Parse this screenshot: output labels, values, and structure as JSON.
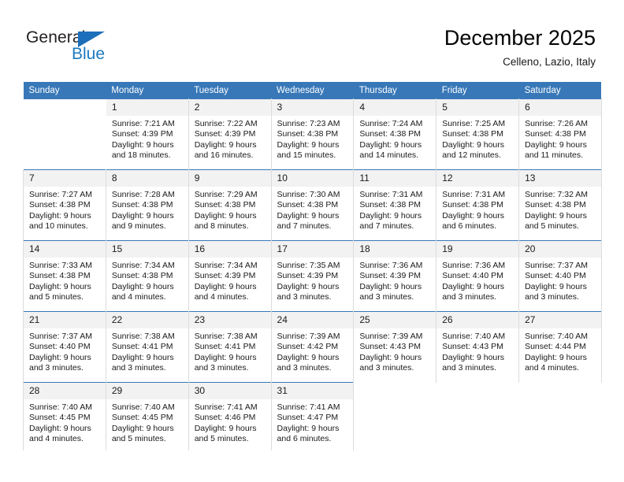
{
  "brand": {
    "name_part1": "General",
    "name_part2": "Blue",
    "accent_color": "#1c7ac0"
  },
  "header": {
    "month_title": "December 2025",
    "location": "Celleno, Lazio, Italy"
  },
  "calendar": {
    "header_bg": "#3878b8",
    "daynum_bg": "#f2f2f2",
    "weekday_headers": [
      "Sunday",
      "Monday",
      "Tuesday",
      "Wednesday",
      "Thursday",
      "Friday",
      "Saturday"
    ],
    "weeks": [
      [
        {
          "day": "",
          "sunrise": "",
          "sunset": "",
          "daylight1": "",
          "daylight2": "",
          "empty": true
        },
        {
          "day": "1",
          "sunrise": "Sunrise: 7:21 AM",
          "sunset": "Sunset: 4:39 PM",
          "daylight1": "Daylight: 9 hours",
          "daylight2": "and 18 minutes.",
          "empty": false
        },
        {
          "day": "2",
          "sunrise": "Sunrise: 7:22 AM",
          "sunset": "Sunset: 4:39 PM",
          "daylight1": "Daylight: 9 hours",
          "daylight2": "and 16 minutes.",
          "empty": false
        },
        {
          "day": "3",
          "sunrise": "Sunrise: 7:23 AM",
          "sunset": "Sunset: 4:38 PM",
          "daylight1": "Daylight: 9 hours",
          "daylight2": "and 15 minutes.",
          "empty": false
        },
        {
          "day": "4",
          "sunrise": "Sunrise: 7:24 AM",
          "sunset": "Sunset: 4:38 PM",
          "daylight1": "Daylight: 9 hours",
          "daylight2": "and 14 minutes.",
          "empty": false
        },
        {
          "day": "5",
          "sunrise": "Sunrise: 7:25 AM",
          "sunset": "Sunset: 4:38 PM",
          "daylight1": "Daylight: 9 hours",
          "daylight2": "and 12 minutes.",
          "empty": false
        },
        {
          "day": "6",
          "sunrise": "Sunrise: 7:26 AM",
          "sunset": "Sunset: 4:38 PM",
          "daylight1": "Daylight: 9 hours",
          "daylight2": "and 11 minutes.",
          "empty": false
        }
      ],
      [
        {
          "day": "7",
          "sunrise": "Sunrise: 7:27 AM",
          "sunset": "Sunset: 4:38 PM",
          "daylight1": "Daylight: 9 hours",
          "daylight2": "and 10 minutes.",
          "empty": false
        },
        {
          "day": "8",
          "sunrise": "Sunrise: 7:28 AM",
          "sunset": "Sunset: 4:38 PM",
          "daylight1": "Daylight: 9 hours",
          "daylight2": "and 9 minutes.",
          "empty": false
        },
        {
          "day": "9",
          "sunrise": "Sunrise: 7:29 AM",
          "sunset": "Sunset: 4:38 PM",
          "daylight1": "Daylight: 9 hours",
          "daylight2": "and 8 minutes.",
          "empty": false
        },
        {
          "day": "10",
          "sunrise": "Sunrise: 7:30 AM",
          "sunset": "Sunset: 4:38 PM",
          "daylight1": "Daylight: 9 hours",
          "daylight2": "and 7 minutes.",
          "empty": false
        },
        {
          "day": "11",
          "sunrise": "Sunrise: 7:31 AM",
          "sunset": "Sunset: 4:38 PM",
          "daylight1": "Daylight: 9 hours",
          "daylight2": "and 7 minutes.",
          "empty": false
        },
        {
          "day": "12",
          "sunrise": "Sunrise: 7:31 AM",
          "sunset": "Sunset: 4:38 PM",
          "daylight1": "Daylight: 9 hours",
          "daylight2": "and 6 minutes.",
          "empty": false
        },
        {
          "day": "13",
          "sunrise": "Sunrise: 7:32 AM",
          "sunset": "Sunset: 4:38 PM",
          "daylight1": "Daylight: 9 hours",
          "daylight2": "and 5 minutes.",
          "empty": false
        }
      ],
      [
        {
          "day": "14",
          "sunrise": "Sunrise: 7:33 AM",
          "sunset": "Sunset: 4:38 PM",
          "daylight1": "Daylight: 9 hours",
          "daylight2": "and 5 minutes.",
          "empty": false
        },
        {
          "day": "15",
          "sunrise": "Sunrise: 7:34 AM",
          "sunset": "Sunset: 4:38 PM",
          "daylight1": "Daylight: 9 hours",
          "daylight2": "and 4 minutes.",
          "empty": false
        },
        {
          "day": "16",
          "sunrise": "Sunrise: 7:34 AM",
          "sunset": "Sunset: 4:39 PM",
          "daylight1": "Daylight: 9 hours",
          "daylight2": "and 4 minutes.",
          "empty": false
        },
        {
          "day": "17",
          "sunrise": "Sunrise: 7:35 AM",
          "sunset": "Sunset: 4:39 PM",
          "daylight1": "Daylight: 9 hours",
          "daylight2": "and 3 minutes.",
          "empty": false
        },
        {
          "day": "18",
          "sunrise": "Sunrise: 7:36 AM",
          "sunset": "Sunset: 4:39 PM",
          "daylight1": "Daylight: 9 hours",
          "daylight2": "and 3 minutes.",
          "empty": false
        },
        {
          "day": "19",
          "sunrise": "Sunrise: 7:36 AM",
          "sunset": "Sunset: 4:40 PM",
          "daylight1": "Daylight: 9 hours",
          "daylight2": "and 3 minutes.",
          "empty": false
        },
        {
          "day": "20",
          "sunrise": "Sunrise: 7:37 AM",
          "sunset": "Sunset: 4:40 PM",
          "daylight1": "Daylight: 9 hours",
          "daylight2": "and 3 minutes.",
          "empty": false
        }
      ],
      [
        {
          "day": "21",
          "sunrise": "Sunrise: 7:37 AM",
          "sunset": "Sunset: 4:40 PM",
          "daylight1": "Daylight: 9 hours",
          "daylight2": "and 3 minutes.",
          "empty": false
        },
        {
          "day": "22",
          "sunrise": "Sunrise: 7:38 AM",
          "sunset": "Sunset: 4:41 PM",
          "daylight1": "Daylight: 9 hours",
          "daylight2": "and 3 minutes.",
          "empty": false
        },
        {
          "day": "23",
          "sunrise": "Sunrise: 7:38 AM",
          "sunset": "Sunset: 4:41 PM",
          "daylight1": "Daylight: 9 hours",
          "daylight2": "and 3 minutes.",
          "empty": false
        },
        {
          "day": "24",
          "sunrise": "Sunrise: 7:39 AM",
          "sunset": "Sunset: 4:42 PM",
          "daylight1": "Daylight: 9 hours",
          "daylight2": "and 3 minutes.",
          "empty": false
        },
        {
          "day": "25",
          "sunrise": "Sunrise: 7:39 AM",
          "sunset": "Sunset: 4:43 PM",
          "daylight1": "Daylight: 9 hours",
          "daylight2": "and 3 minutes.",
          "empty": false
        },
        {
          "day": "26",
          "sunrise": "Sunrise: 7:40 AM",
          "sunset": "Sunset: 4:43 PM",
          "daylight1": "Daylight: 9 hours",
          "daylight2": "and 3 minutes.",
          "empty": false
        },
        {
          "day": "27",
          "sunrise": "Sunrise: 7:40 AM",
          "sunset": "Sunset: 4:44 PM",
          "daylight1": "Daylight: 9 hours",
          "daylight2": "and 4 minutes.",
          "empty": false
        }
      ],
      [
        {
          "day": "28",
          "sunrise": "Sunrise: 7:40 AM",
          "sunset": "Sunset: 4:45 PM",
          "daylight1": "Daylight: 9 hours",
          "daylight2": "and 4 minutes.",
          "empty": false
        },
        {
          "day": "29",
          "sunrise": "Sunrise: 7:40 AM",
          "sunset": "Sunset: 4:45 PM",
          "daylight1": "Daylight: 9 hours",
          "daylight2": "and 5 minutes.",
          "empty": false
        },
        {
          "day": "30",
          "sunrise": "Sunrise: 7:41 AM",
          "sunset": "Sunset: 4:46 PM",
          "daylight1": "Daylight: 9 hours",
          "daylight2": "and 5 minutes.",
          "empty": false
        },
        {
          "day": "31",
          "sunrise": "Sunrise: 7:41 AM",
          "sunset": "Sunset: 4:47 PM",
          "daylight1": "Daylight: 9 hours",
          "daylight2": "and 6 minutes.",
          "empty": false
        },
        {
          "day": "",
          "sunrise": "",
          "sunset": "",
          "daylight1": "",
          "daylight2": "",
          "empty": true
        },
        {
          "day": "",
          "sunrise": "",
          "sunset": "",
          "daylight1": "",
          "daylight2": "",
          "empty": true
        },
        {
          "day": "",
          "sunrise": "",
          "sunset": "",
          "daylight1": "",
          "daylight2": "",
          "empty": true
        }
      ]
    ]
  }
}
